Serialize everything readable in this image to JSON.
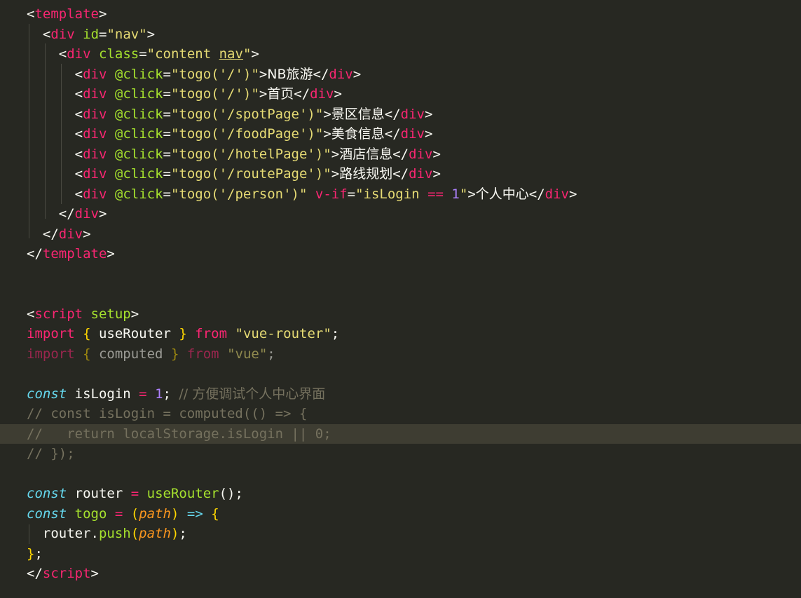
{
  "editor": {
    "theme_colors": {
      "background": "#272822",
      "tag": "#f92672",
      "attribute": "#a6e22e",
      "string": "#e6db74",
      "comment": "#75715e",
      "storage": "#66d9ef",
      "number": "#ae81ff",
      "parameter": "#fd971f"
    },
    "lines": [
      [
        [
          "punct",
          "<"
        ],
        [
          "tag",
          "template"
        ],
        [
          "punct",
          ">"
        ]
      ],
      [
        [
          "plain",
          "  "
        ],
        [
          "punct",
          "<"
        ],
        [
          "tag",
          "div"
        ],
        [
          "plain",
          " "
        ],
        [
          "attr",
          "id"
        ],
        [
          "punct",
          "="
        ],
        [
          "str",
          "\"nav\""
        ],
        [
          "punct",
          ">"
        ]
      ],
      [
        [
          "plain",
          "    "
        ],
        [
          "punct",
          "<"
        ],
        [
          "tag",
          "div"
        ],
        [
          "plain",
          " "
        ],
        [
          "attr",
          "class"
        ],
        [
          "punct",
          "="
        ],
        [
          "str",
          "\"content "
        ],
        [
          "strU",
          "nav"
        ],
        [
          "str",
          "\""
        ],
        [
          "punct",
          ">"
        ]
      ],
      [
        [
          "plain",
          "      "
        ],
        [
          "punct",
          "<"
        ],
        [
          "tag",
          "div"
        ],
        [
          "plain",
          " "
        ],
        [
          "attr",
          "@click"
        ],
        [
          "punct",
          "="
        ],
        [
          "str",
          "\"togo('/')\""
        ],
        [
          "punct",
          ">"
        ],
        [
          "text",
          "NB旅游"
        ],
        [
          "punct",
          "</"
        ],
        [
          "tag",
          "div"
        ],
        [
          "punct",
          ">"
        ]
      ],
      [
        [
          "plain",
          "      "
        ],
        [
          "punct",
          "<"
        ],
        [
          "tag",
          "div"
        ],
        [
          "plain",
          " "
        ],
        [
          "attr",
          "@click"
        ],
        [
          "punct",
          "="
        ],
        [
          "str",
          "\"togo('/')\""
        ],
        [
          "punct",
          ">"
        ],
        [
          "text",
          "首页"
        ],
        [
          "punct",
          "</"
        ],
        [
          "tag",
          "div"
        ],
        [
          "punct",
          ">"
        ]
      ],
      [
        [
          "plain",
          "      "
        ],
        [
          "punct",
          "<"
        ],
        [
          "tag",
          "div"
        ],
        [
          "plain",
          " "
        ],
        [
          "attr",
          "@click"
        ],
        [
          "punct",
          "="
        ],
        [
          "str",
          "\"togo('/spotPage')\""
        ],
        [
          "punct",
          ">"
        ],
        [
          "text",
          "景区信息"
        ],
        [
          "punct",
          "</"
        ],
        [
          "tag",
          "div"
        ],
        [
          "punct",
          ">"
        ]
      ],
      [
        [
          "plain",
          "      "
        ],
        [
          "punct",
          "<"
        ],
        [
          "tag",
          "div"
        ],
        [
          "plain",
          " "
        ],
        [
          "attr",
          "@click"
        ],
        [
          "punct",
          "="
        ],
        [
          "str",
          "\"togo('/foodPage')\""
        ],
        [
          "punct",
          ">"
        ],
        [
          "text",
          "美食信息"
        ],
        [
          "punct",
          "</"
        ],
        [
          "tag",
          "div"
        ],
        [
          "punct",
          ">"
        ]
      ],
      [
        [
          "plain",
          "      "
        ],
        [
          "punct",
          "<"
        ],
        [
          "tag",
          "div"
        ],
        [
          "plain",
          " "
        ],
        [
          "attr",
          "@click"
        ],
        [
          "punct",
          "="
        ],
        [
          "str",
          "\"togo('/hotelPage')\""
        ],
        [
          "punct",
          ">"
        ],
        [
          "text",
          "酒店信息"
        ],
        [
          "punct",
          "</"
        ],
        [
          "tag",
          "div"
        ],
        [
          "punct",
          ">"
        ]
      ],
      [
        [
          "plain",
          "      "
        ],
        [
          "punct",
          "<"
        ],
        [
          "tag",
          "div"
        ],
        [
          "plain",
          " "
        ],
        [
          "attr",
          "@click"
        ],
        [
          "punct",
          "="
        ],
        [
          "str",
          "\"togo('/routePage')\""
        ],
        [
          "punct",
          ">"
        ],
        [
          "text",
          "路线规划"
        ],
        [
          "punct",
          "</"
        ],
        [
          "tag",
          "div"
        ],
        [
          "punct",
          ">"
        ]
      ],
      [
        [
          "plain",
          "      "
        ],
        [
          "punct",
          "<"
        ],
        [
          "tag",
          "div"
        ],
        [
          "plain",
          " "
        ],
        [
          "attr",
          "@click"
        ],
        [
          "punct",
          "="
        ],
        [
          "str",
          "\"togo('/person')\""
        ],
        [
          "plain",
          " "
        ],
        [
          "tag",
          "v-if"
        ],
        [
          "punct",
          "="
        ],
        [
          "str",
          "\"isLogin "
        ],
        [
          "tag",
          "=="
        ],
        [
          "plain",
          " "
        ],
        [
          "num",
          "1"
        ],
        [
          "str",
          "\""
        ],
        [
          "punct",
          ">"
        ],
        [
          "text",
          "个人中心"
        ],
        [
          "punct",
          "</"
        ],
        [
          "tag",
          "div"
        ],
        [
          "punct",
          ">"
        ]
      ],
      [
        [
          "plain",
          "    "
        ],
        [
          "punct",
          "</"
        ],
        [
          "tag",
          "div"
        ],
        [
          "punct",
          ">"
        ]
      ],
      [
        [
          "plain",
          "  "
        ],
        [
          "punct",
          "</"
        ],
        [
          "tag",
          "div"
        ],
        [
          "punct",
          ">"
        ]
      ],
      [
        [
          "punct",
          "</"
        ],
        [
          "tag",
          "template"
        ],
        [
          "punct",
          ">"
        ]
      ],
      [],
      [],
      [
        [
          "punct",
          "<"
        ],
        [
          "tag",
          "script"
        ],
        [
          "plain",
          " "
        ],
        [
          "attr",
          "setup"
        ],
        [
          "punct",
          ">"
        ]
      ],
      [
        [
          "kw",
          "import"
        ],
        [
          "plain",
          " "
        ],
        [
          "brace",
          "{"
        ],
        [
          "plain",
          " useRouter "
        ],
        [
          "brace",
          "}"
        ],
        [
          "plain",
          " "
        ],
        [
          "kw",
          "from"
        ],
        [
          "plain",
          " "
        ],
        [
          "str",
          "\"vue-router\""
        ],
        [
          "plain",
          ";"
        ]
      ],
      [
        [
          "dimkw",
          "import"
        ],
        [
          "plain",
          " "
        ],
        [
          "dimbrace",
          "{"
        ],
        [
          "dimplain",
          " computed "
        ],
        [
          "dimbrace",
          "}"
        ],
        [
          "plain",
          " "
        ],
        [
          "dimkw",
          "from"
        ],
        [
          "plain",
          " "
        ],
        [
          "dimstr",
          "\"vue\""
        ],
        [
          "dimplain",
          ";"
        ]
      ],
      [],
      [
        [
          "storage",
          "const"
        ],
        [
          "plain",
          " isLogin "
        ],
        [
          "kw",
          "="
        ],
        [
          "plain",
          " "
        ],
        [
          "num",
          "1"
        ],
        [
          "plain",
          "; "
        ],
        [
          "comment",
          "// 方便调试个人中心界面"
        ]
      ],
      [
        [
          "comment",
          "// const isLogin = computed(() => {"
        ]
      ],
      [
        [
          "comment",
          "//   return localStorage.isLogin || 0;"
        ]
      ],
      [
        [
          "comment",
          "// });"
        ]
      ],
      [],
      [
        [
          "storage",
          "const"
        ],
        [
          "plain",
          " router "
        ],
        [
          "kw",
          "="
        ],
        [
          "plain",
          " "
        ],
        [
          "fn",
          "useRouter"
        ],
        [
          "plain",
          "();"
        ]
      ],
      [
        [
          "storage",
          "const"
        ],
        [
          "plain",
          " "
        ],
        [
          "fn",
          "togo"
        ],
        [
          "plain",
          " "
        ],
        [
          "kw",
          "="
        ],
        [
          "plain",
          " "
        ],
        [
          "brace",
          "("
        ],
        [
          "param",
          "path"
        ],
        [
          "brace",
          ")"
        ],
        [
          "plain",
          " "
        ],
        [
          "storage2",
          "=>"
        ],
        [
          "plain",
          " "
        ],
        [
          "brace",
          "{"
        ]
      ],
      [
        [
          "plain",
          "  router."
        ],
        [
          "fn",
          "push"
        ],
        [
          "brace",
          "("
        ],
        [
          "param",
          "path"
        ],
        [
          "brace",
          ")"
        ],
        [
          "plain",
          ";"
        ]
      ],
      [
        [
          "brace",
          "}"
        ],
        [
          "plain",
          ";"
        ]
      ],
      [
        [
          "punct",
          "</"
        ],
        [
          "tag",
          "script"
        ],
        [
          "punct",
          ">"
        ]
      ]
    ],
    "highlighted_line": 21
  }
}
